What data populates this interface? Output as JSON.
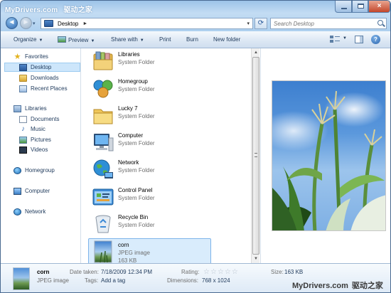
{
  "watermark": {
    "site": "MyDrivers.com",
    "cn": "驱动之家"
  },
  "window": {
    "close_glyph": "×"
  },
  "nav": {
    "back_glyph": "◄",
    "forward_glyph": "►",
    "dropdown_glyph": "▾"
  },
  "address": {
    "crumb": "Desktop",
    "separator": "►",
    "dropdown_glyph": "▾",
    "refresh_glyph": "⟳"
  },
  "search": {
    "placeholder": "Search Desktop"
  },
  "toolbar": {
    "organize": "Organize",
    "preview": "Preview",
    "share_with": "Share with",
    "print": "Print",
    "burn": "Burn",
    "new_folder": "New folder",
    "caret": "▼",
    "help_glyph": "?"
  },
  "sidebar": {
    "favorites": "Favorites",
    "desktop": "Desktop",
    "downloads": "Downloads",
    "recent_places": "Recent Places",
    "libraries": "Libraries",
    "documents": "Documents",
    "music": "Music",
    "pictures": "Pictures",
    "videos": "Videos",
    "homegroup": "Homegroup",
    "computer": "Computer",
    "network": "Network"
  },
  "files": [
    {
      "name": "Libraries",
      "type": "System Folder",
      "icon": "libraries-icon"
    },
    {
      "name": "Homegroup",
      "type": "System Folder",
      "icon": "homegroup-icon"
    },
    {
      "name": "Lucky 7",
      "type": "System Folder",
      "icon": "user-folder-icon"
    },
    {
      "name": "Computer",
      "type": "System Folder",
      "icon": "computer-icon"
    },
    {
      "name": "Network",
      "type": "System Folder",
      "icon": "network-icon"
    },
    {
      "name": "Control Panel",
      "type": "System Folder",
      "icon": "control-panel-icon"
    },
    {
      "name": "Recycle Bin",
      "type": "System Folder",
      "icon": "recycle-bin-icon"
    },
    {
      "name": "corn",
      "type": "JPEG image",
      "size": "163 KB",
      "icon": "image-thumbnail"
    }
  ],
  "details": {
    "name": "corn",
    "type": "JPEG image",
    "date_taken_label": "Date taken:",
    "date_taken": "7/18/2009 12:34 PM",
    "tags_label": "Tags:",
    "tags_placeholder": "Add a tag",
    "rating_label": "Rating:",
    "rating": 0,
    "star_glyph": "☆",
    "dimensions_label": "Dimensions:",
    "dimensions": "768 x 1024",
    "size_label": "Size:",
    "size": "163 KB"
  },
  "scrollbar": {
    "up_glyph": "▲",
    "down_glyph": "▼"
  }
}
